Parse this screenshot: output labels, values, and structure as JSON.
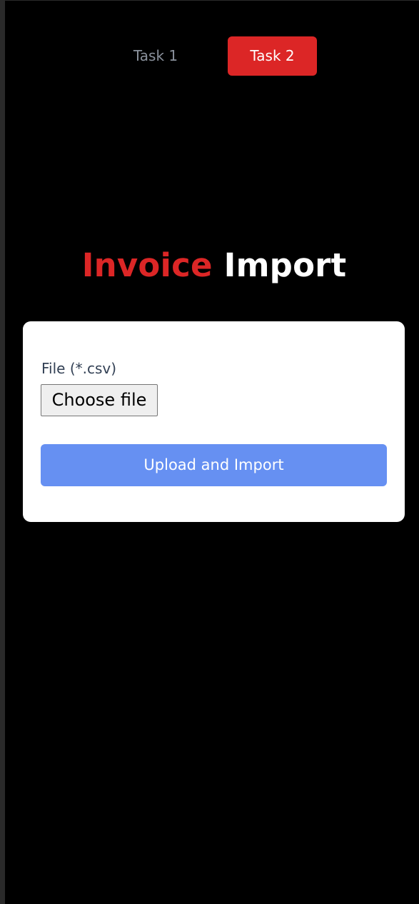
{
  "tabs": [
    {
      "label": "Task 1",
      "active": false
    },
    {
      "label": "Task 2",
      "active": true
    }
  ],
  "heading": {
    "word1": "Invoice",
    "word2": "Import"
  },
  "form": {
    "file_label": "File (*.csv)",
    "choose_file_label": "Choose file",
    "submit_label": "Upload and Import"
  },
  "colors": {
    "accent_red": "#dc2626",
    "button_blue": "#6690f2",
    "background": "#000000",
    "card": "#ffffff"
  }
}
